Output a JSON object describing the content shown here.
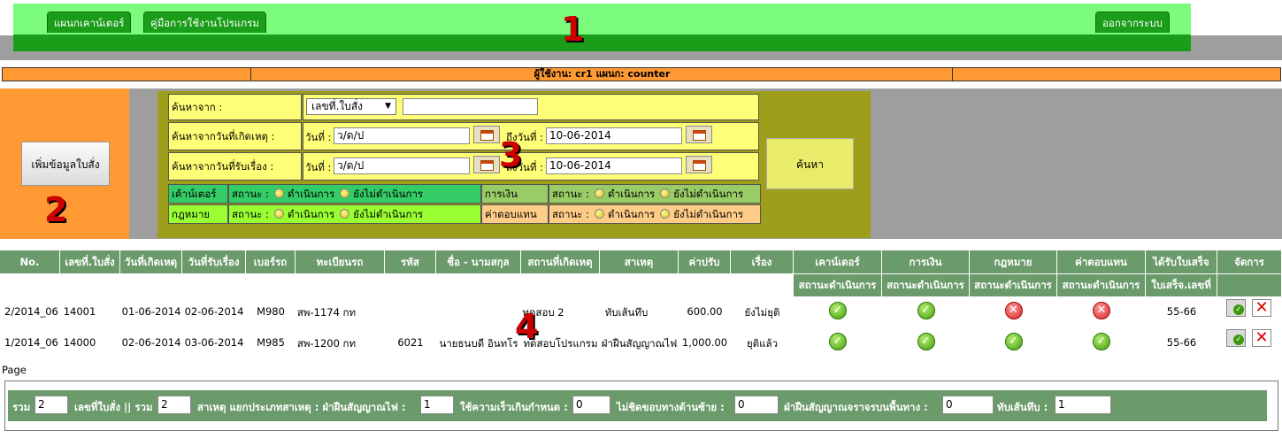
{
  "nav": {
    "tabs": [
      {
        "label": "แผนกเคาน์เตอร์"
      },
      {
        "label": "คู่มือการใช้งานโปรแกรม"
      }
    ],
    "logout": "ออกจากระบบ"
  },
  "annotations": [
    "1",
    "2",
    "3",
    "4"
  ],
  "userbar": {
    "text": "ผู้ใช้งาน: cr1    แผนก: counter"
  },
  "add_button": "เพิ่มข้อมูลใบสั่ง",
  "search": {
    "from_label": "ค้นหาจาก :",
    "from_select": "เลขที่.ใบสั่ง",
    "from_value": "",
    "incident_label": "ค้นหาจากวันที่เกิดเหตุ :",
    "receive_label": "ค้นหาจากวันที่รับเรื่อง :",
    "date_label": "วันที่ :",
    "to_label": "ถึงวันที่ :",
    "date_placeholder": "ว/ด/ป",
    "to_date": "10-06-2014",
    "search_button": "ค้นหา",
    "status_rows": [
      {
        "dept": "เค้าน์เตอร์",
        "dept_color": "#33cc66",
        "status_color": "#33cc66"
      },
      {
        "dept": "กฎหมาย",
        "dept_color": "#99ff33",
        "status_color": "#99ff33"
      }
    ],
    "status_rows_right": [
      {
        "dept": "การเงิน",
        "dept_color": "#99cc66",
        "status_color": "#99cc66"
      },
      {
        "dept": "ค่าตอบแทน",
        "dept_color": "#ffcc88",
        "status_color": "#ffcc88"
      }
    ],
    "status_label": "สถานะ :",
    "opt_done": "ดำเนินการ",
    "opt_pending": "ยังไม่ดำเนินการ"
  },
  "table": {
    "headers": [
      "No.",
      "เลขที่.ใบสั่ง",
      "วันที่เกิดเหตุ",
      "วันที่รับเรื่อง",
      "เบอร์รถ",
      "ทะเบียนรถ",
      "รหัส",
      "ชื่อ - นามสกุล",
      "สถานที่เกิดเหตุ",
      "สาเหตุ",
      "ค่าปรับ",
      "เรื่อง",
      "เคาน์เตอร์",
      "การเงิน",
      "กฎหมาย",
      "ค่าตอบแทน",
      "ได้รับใบเสร็จ",
      "จัดการ"
    ],
    "subheaders": [
      "สถานะดำเนินการ",
      "สถานะดำเนินการ",
      "สถานะดำเนินการ",
      "สถานะดำเนินการ",
      "ใบเสร็จ.เลขที่"
    ],
    "rows": [
      {
        "no": "2/2014_06",
        "ticket": "14001",
        "incident": "01-06-2014",
        "received": "02-06-2014",
        "car_no": "M980",
        "plate": "สพ-1174 กท",
        "code": "",
        "name": "",
        "place": "ทดสอบ 2",
        "cause": "ทับเส้นทึบ",
        "fine": "600.00",
        "matter": "ยังไม่ยุติ",
        "counter": "ok",
        "finance": "ok",
        "law": "no",
        "comp": "no",
        "receipt": "55-66"
      },
      {
        "no": "1/2014_06",
        "ticket": "14000",
        "incident": "02-06-2014",
        "received": "03-06-2014",
        "car_no": "M985",
        "plate": "สพ-1200 กท",
        "code": "6021",
        "name": "นายธนบดี อินทโร",
        "place": "ทดสอบโปรแกรม",
        "cause": "ฝ่าฝืนสัญญาณไฟ",
        "fine": "1,000.00",
        "matter": "ยุติแล้ว",
        "counter": "ok",
        "finance": "ok",
        "law": "ok",
        "comp": "ok",
        "receipt": "55-66"
      }
    ]
  },
  "page_label": "Page",
  "summary": {
    "total_label": "รวม",
    "total": "2",
    "ticket_label": "เลขที่ใบสั่ง || รวม",
    "ticket_total": "2",
    "cause_label": "สาเหตุ  แยกประเภทสาเหตุ : ฝ่าฝืนสัญญาณไฟ :",
    "red_light": "1",
    "speed_label": "ใช้ความเร็วเกินกำหนด :",
    "speed": "0",
    "left_label": "ไม่ชิดขอบทางด้านซ้าย :",
    "left": "0",
    "road_label": "ฝ่าฝืนสัญญาณจราจรบนพื้นทาง :",
    "road": "0",
    "solid_label": "ทับเส้นทึบ :",
    "solid": "1"
  },
  "colors": {
    "green": "#1a9e1a",
    "orange": "#ff9933",
    "table_header": "#6b9a6b"
  }
}
